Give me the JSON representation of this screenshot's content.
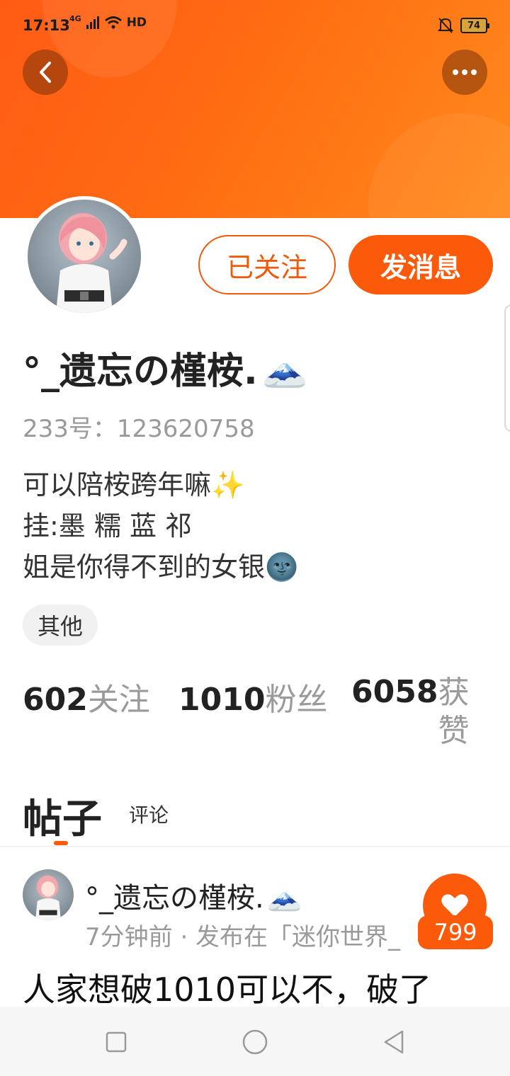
{
  "status_bar": {
    "time": "17:13",
    "network": "4G",
    "hd_label": "HD",
    "battery": "74"
  },
  "profile": {
    "username": "°_遗忘の槿桉.",
    "username_emoji": "🗻",
    "id_text": "233号：123620758",
    "bio_lines": [
      {
        "text": "可以陪桉跨年嘛",
        "emoji": "✨"
      },
      {
        "text": "挂:墨 糯 蓝 祁",
        "emoji": ""
      },
      {
        "text": "姐是你得不到的女银",
        "emoji": "🌚"
      }
    ],
    "tag": "其他"
  },
  "actions": {
    "follow_label": "已关注",
    "message_label": "发消息"
  },
  "stats": [
    {
      "value": "602",
      "label": "关注"
    },
    {
      "value": "1010",
      "label": "粉丝"
    },
    {
      "value": "6058",
      "label": "获赞"
    }
  ],
  "tabs": {
    "posts": "帖子",
    "comments": "评论"
  },
  "post": {
    "author": "°_遗忘の槿桉.",
    "author_emoji": "🗻",
    "meta": "7分钟前 · 发布在「迷你世界_",
    "text": "人家想破1010可以不，破了",
    "likes": "799"
  },
  "colors": {
    "accent": "#fb5a0b",
    "banner_start": "#ff5b14",
    "banner_end": "#ff8a1c"
  }
}
